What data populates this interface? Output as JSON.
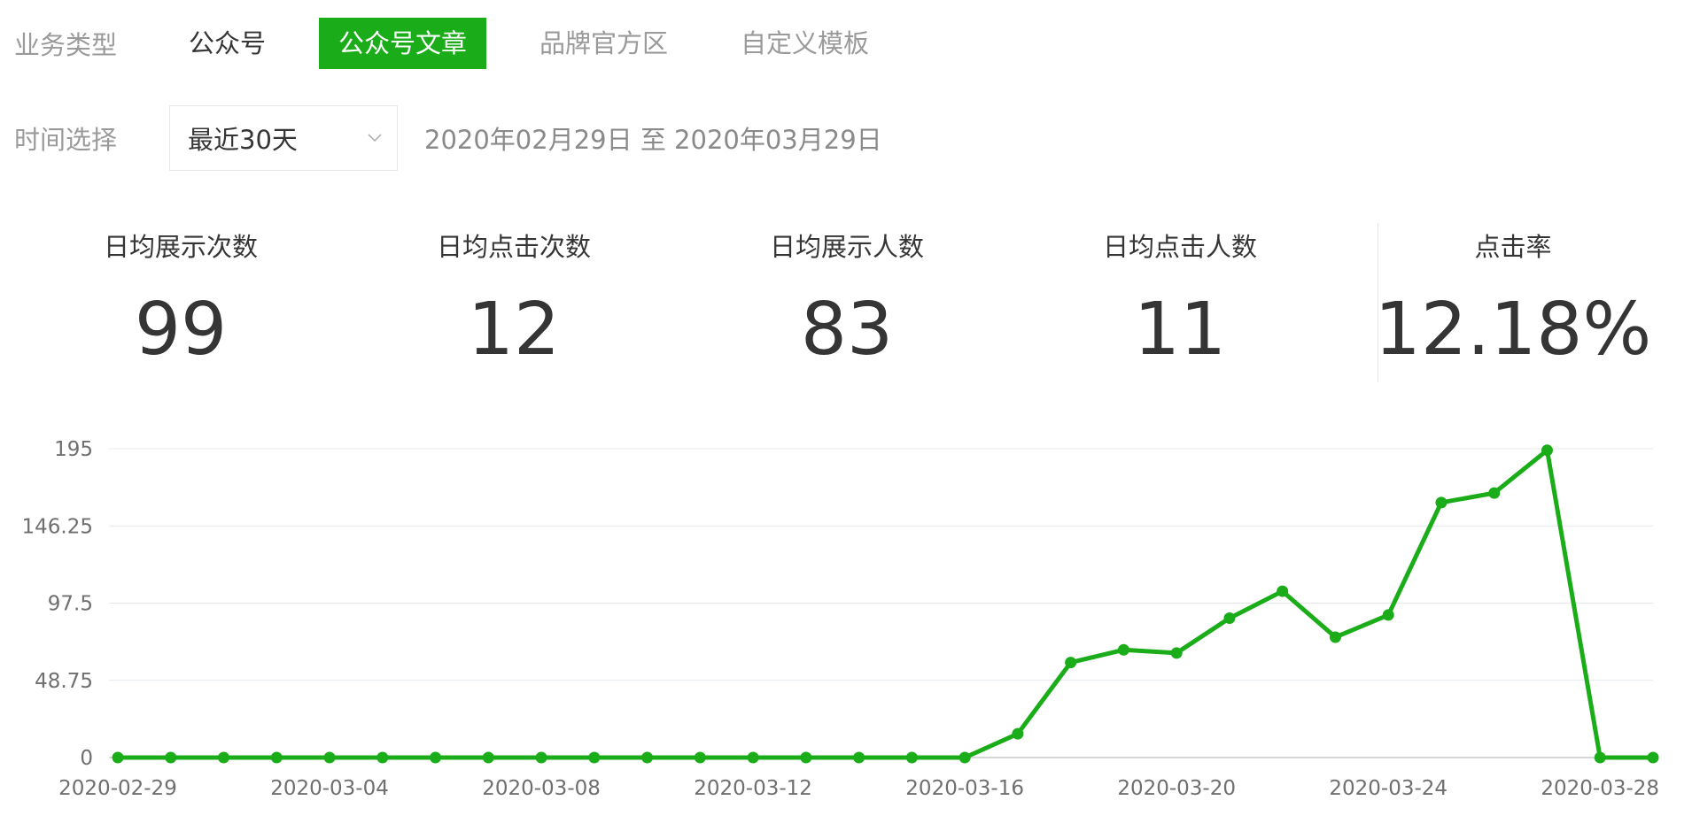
{
  "business_type": {
    "label": "业务类型",
    "tabs": [
      {
        "label": "公众号",
        "state": "plain"
      },
      {
        "label": "公众号文章",
        "state": "active"
      },
      {
        "label": "品牌官方区",
        "state": "muted"
      },
      {
        "label": "自定义模板",
        "state": "muted"
      }
    ]
  },
  "time_select": {
    "label": "时间选择",
    "selected": "最近30天",
    "range_text": "2020年02月29日 至 2020年03月29日"
  },
  "stats": [
    {
      "label": "日均展示次数",
      "value": "99"
    },
    {
      "label": "日均点击次数",
      "value": "12"
    },
    {
      "label": "日均展示人数",
      "value": "83"
    },
    {
      "label": "日均点击人数",
      "value": "11"
    },
    {
      "label": "点击率",
      "value": "12.18%"
    }
  ],
  "colors": {
    "accent": "#1aad19",
    "grid": "#e4e8eb",
    "text": "#353535",
    "muted": "#9a9a9a"
  },
  "chart_data": {
    "type": "line",
    "title": "",
    "xlabel": "",
    "ylabel": "",
    "x": [
      "2020-02-29",
      "2020-03-01",
      "2020-03-02",
      "2020-03-03",
      "2020-03-04",
      "2020-03-05",
      "2020-03-06",
      "2020-03-07",
      "2020-03-08",
      "2020-03-09",
      "2020-03-10",
      "2020-03-11",
      "2020-03-12",
      "2020-03-13",
      "2020-03-14",
      "2020-03-15",
      "2020-03-16",
      "2020-03-17",
      "2020-03-18",
      "2020-03-19",
      "2020-03-20",
      "2020-03-21",
      "2020-03-22",
      "2020-03-23",
      "2020-03-24",
      "2020-03-25",
      "2020-03-26",
      "2020-03-27",
      "2020-03-28",
      "2020-03-29"
    ],
    "x_tick_labels": [
      "2020-02-29",
      "2020-03-04",
      "2020-03-08",
      "2020-03-12",
      "2020-03-16",
      "2020-03-20",
      "2020-03-24",
      "2020-03-28"
    ],
    "y_ticks": [
      "0",
      "48.75",
      "97.5",
      "146.25",
      "195"
    ],
    "ylim": [
      0,
      195
    ],
    "grid": true,
    "series": [
      {
        "values": [
          0,
          0,
          0,
          0,
          0,
          0,
          0,
          0,
          0,
          0,
          0,
          0,
          0,
          0,
          0,
          0,
          0,
          15,
          60,
          68,
          66,
          88,
          105,
          76,
          90,
          161,
          167,
          194,
          0,
          0
        ],
        "color": "#1aad19"
      }
    ]
  }
}
